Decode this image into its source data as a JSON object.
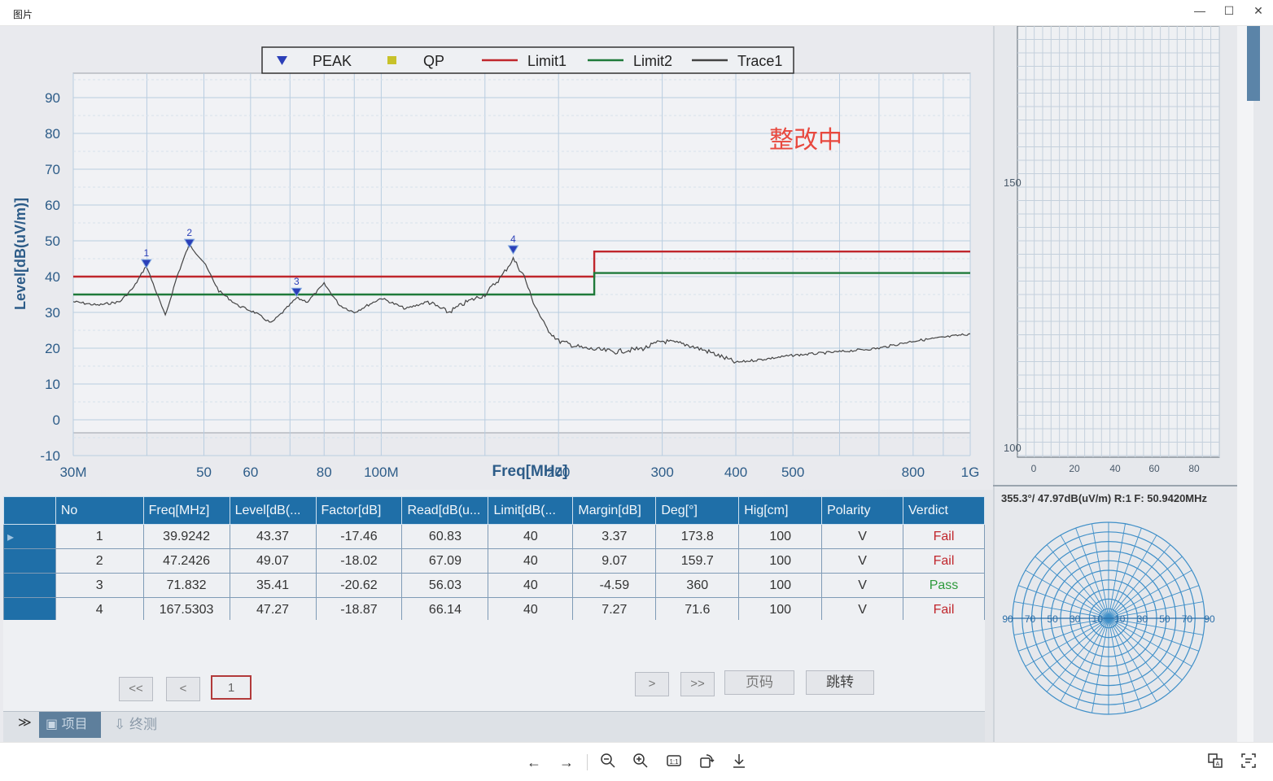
{
  "window": {
    "title": "图片",
    "minimize": "—",
    "maximize": "☐",
    "close": "✕"
  },
  "chart_data": {
    "type": "line",
    "xlabel": "Freq[MHz]",
    "ylabel": "Level[dB(uV/m)]",
    "xscale": "log",
    "xlim": [
      30,
      1000
    ],
    "ylim": [
      -10,
      90
    ],
    "grid": true,
    "legend_position": "top-center",
    "x_tick_labels": [
      "30M",
      "50",
      "60",
      "80",
      "100M",
      "200",
      "300",
      "400",
      "500",
      "800",
      "1G"
    ],
    "x_tick_values": [
      30,
      50,
      60,
      80,
      100,
      200,
      300,
      400,
      500,
      800,
      1000
    ],
    "y_tick_labels": [
      "90",
      "80",
      "70",
      "60",
      "50",
      "40",
      "30",
      "20",
      "10",
      "0",
      "-10"
    ],
    "y_tick_values": [
      90,
      80,
      70,
      60,
      50,
      40,
      30,
      20,
      10,
      0,
      -10
    ],
    "legend": [
      {
        "name": "PEAK",
        "marker": "triangle",
        "color": "#2b3fb8"
      },
      {
        "name": "QP",
        "marker": "square",
        "color": "#c8c22a"
      },
      {
        "name": "Limit1",
        "marker": "line",
        "color": "#c0262c"
      },
      {
        "name": "Limit2",
        "marker": "line",
        "color": "#1f7a3a"
      },
      {
        "name": "Trace1",
        "marker": "line",
        "color": "#444444"
      }
    ],
    "series": [
      {
        "name": "Limit1",
        "color": "#c0262c",
        "x": [
          30,
          230,
          230,
          1000
        ],
        "y": [
          40,
          40,
          47,
          47
        ]
      },
      {
        "name": "Limit2",
        "color": "#1f7a3a",
        "x": [
          30,
          230,
          230,
          1000
        ],
        "y": [
          35,
          35,
          41,
          41
        ]
      },
      {
        "name": "Trace1",
        "color": "#444444",
        "x": [
          30,
          33,
          36,
          38,
          39.9,
          41,
          43,
          45,
          47.2,
          50,
          53,
          57,
          61,
          65,
          68,
          71.8,
          75,
          80,
          85,
          90,
          100,
          110,
          120,
          130,
          140,
          150,
          160,
          167.5,
          175,
          180,
          190,
          200,
          220,
          250,
          280,
          300,
          330,
          360,
          400,
          450,
          500,
          600,
          700,
          800,
          900,
          1000
        ],
        "y": [
          33,
          32,
          33,
          37,
          43,
          38,
          29,
          40,
          49,
          44,
          36,
          32,
          30,
          27,
          30,
          34,
          33,
          38,
          32,
          30,
          34,
          31,
          33,
          30,
          33,
          35,
          40,
          45,
          40,
          34,
          26,
          22,
          20,
          19,
          20,
          22,
          21,
          19,
          16,
          17,
          18,
          19,
          20,
          22,
          23,
          24
        ]
      }
    ],
    "markers": [
      {
        "label": "1",
        "x": 39.9242,
        "y": 43.37
      },
      {
        "label": "2",
        "x": 47.2426,
        "y": 49.07
      },
      {
        "label": "3",
        "x": 71.832,
        "y": 35.41
      },
      {
        "label": "4",
        "x": 167.5303,
        "y": 47.27
      }
    ],
    "annotation": "整改中"
  },
  "side_panel": {
    "y_ticks": [
      "150",
      "100"
    ],
    "x_ticks": [
      "0",
      "20",
      "40",
      "60",
      "80"
    ],
    "status": "355.3°/ 47.97dB(uV/m) R:1 F: 50.9420MHz",
    "polar_labels": [
      "90",
      "70",
      "50",
      "30",
      "10",
      "10",
      "30",
      "50",
      "70",
      "90"
    ]
  },
  "table": {
    "headers": [
      "No",
      "Freq[MHz]",
      "Level[dB(...",
      "Factor[dB]",
      "Read[dB(u...",
      "Limit[dB(...",
      "Margin[dB]",
      "Deg[°]",
      "Hig[cm]",
      "Polarity",
      "Verdict"
    ],
    "rows": [
      [
        "1",
        "39.9242",
        "43.37",
        "-17.46",
        "60.83",
        "40",
        "3.37",
        "173.8",
        "100",
        "V",
        "Fail"
      ],
      [
        "2",
        "47.2426",
        "49.07",
        "-18.02",
        "67.09",
        "40",
        "9.07",
        "159.7",
        "100",
        "V",
        "Fail"
      ],
      [
        "3",
        "71.832",
        "35.41",
        "-20.62",
        "56.03",
        "40",
        "-4.59",
        "360",
        "100",
        "V",
        "Pass"
      ],
      [
        "4",
        "167.5303",
        "47.27",
        "-18.87",
        "66.14",
        "40",
        "7.27",
        "71.6",
        "100",
        "V",
        "Fail"
      ]
    ],
    "verdict_colors": {
      "Fail": "#c0262c",
      "Pass": "#2e9a3c"
    }
  },
  "pager": {
    "first": "<<",
    "prev": "<",
    "page": "1",
    "next": ">",
    "last": ">>",
    "page_input": "页码",
    "jump": "跳转"
  },
  "bottom_tabs": {
    "collapse": "≫",
    "tab1": "项目",
    "tab2": "终测"
  },
  "toolbar": [
    "arrow-left-icon",
    "arrow-right-icon",
    "zoom-out-icon",
    "zoom-in-icon",
    "actual-size-icon",
    "rotate-icon",
    "download-icon",
    "translate-icon",
    "ocr-icon"
  ]
}
